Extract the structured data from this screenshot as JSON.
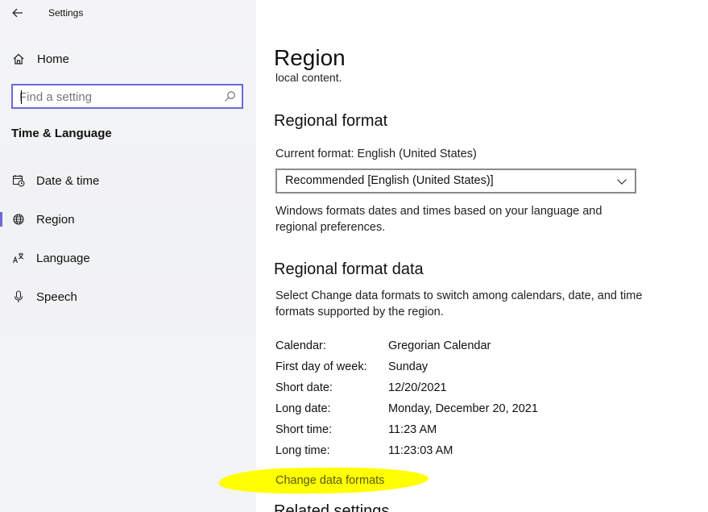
{
  "app": {
    "title": "Settings"
  },
  "sidebar": {
    "home_label": "Home",
    "search_placeholder": "Find a setting",
    "section_heading": "Time & Language",
    "items": [
      {
        "label": "Date & time",
        "icon": "date-time-icon"
      },
      {
        "label": "Region",
        "icon": "globe-icon",
        "selected": true
      },
      {
        "label": "Language",
        "icon": "language-icon"
      },
      {
        "label": "Speech",
        "icon": "microphone-icon"
      }
    ],
    "accent_color": "#6b69d6"
  },
  "main": {
    "title": "Region",
    "cut_text": "local content.",
    "regional_format": {
      "heading": "Regional format",
      "current_format": "Current format: English (United States)",
      "dropdown_value": "Recommended [English (United States)]",
      "description": "Windows formats dates and times based on your language and regional preferences."
    },
    "regional_format_data": {
      "heading": "Regional format data",
      "description": "Select Change data formats to switch among calendars, date, and time formats supported by the region.",
      "rows": [
        {
          "label": "Calendar:",
          "value": "Gregorian Calendar"
        },
        {
          "label": "First day of week:",
          "value": "Sunday"
        },
        {
          "label": "Short date:",
          "value": "12/20/2021"
        },
        {
          "label": "Long date:",
          "value": "Monday, December 20, 2021"
        },
        {
          "label": "Short time:",
          "value": "11:23 AM"
        },
        {
          "label": "Long time:",
          "value": "11:23:03 AM"
        }
      ]
    },
    "change_link": "Change data formats",
    "related_heading": "Related settings",
    "highlight_color": "#ffff00"
  }
}
